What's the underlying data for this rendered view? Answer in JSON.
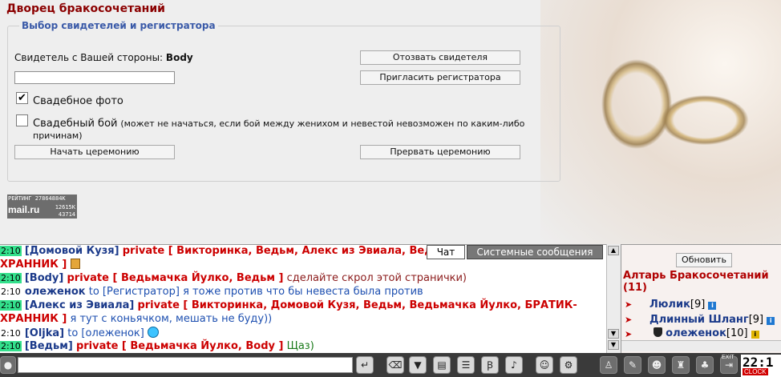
{
  "page_title": "Дворец бракосочетаний",
  "panel": {
    "legend": "Выбор свидетелей и регистратора",
    "witness_label": "Свидетель с Вашей стороны:",
    "witness_name": "Body",
    "recall_witness_button": "Отозвать свидетеля",
    "invite_registrar_button": "Пригласить регистратора",
    "registrar_input_value": "",
    "photo_checkbox": {
      "checked": true,
      "mark": "✔",
      "label": "Свадебное фото"
    },
    "fight_checkbox": {
      "checked": false,
      "label": "Свадебный бой",
      "note": "(может не начаться, если бой между женихом и невестой невозможен по каким-либо причинам)"
    },
    "start_ceremony_button": "Начать церемонию",
    "abort_ceremony_button": "Прервать церемонию"
  },
  "rating_widget": {
    "line1": "РЕЙТИНГ 27864884К",
    "logo": "mail.ru",
    "count2": "12615К",
    "count3": "43714"
  },
  "chat_tabs": {
    "chat": "Чат",
    "system": "Системные сообщения"
  },
  "chat_messages": [
    {
      "time": "2:10",
      "nick": "[Домовой Кузя]",
      "private": "private [ Викторинка, Ведьм, Алекс из Эвиала, Вед",
      "continuation": "ХРАННИК ]"
    },
    {
      "time": "2:10",
      "nick": "[Body]",
      "private": "private [ Ведьмачка Йулко, Ведьм ]",
      "text": "сделайте скрол этой странички)"
    },
    {
      "time": "2:10",
      "nick": "олеженок",
      "to": "to [Регистратор]",
      "text": "я тоже против что бы невеста была против"
    },
    {
      "time": "2:10",
      "nick": "[Алекс из Эвиала]",
      "private": "private [ Викторинка, Домовой Кузя, Ведьм, Ведьмачка Йулко, БРАТИК-",
      "continuation": "ХРАННИК ]",
      "text": "я тут с коньячком, мешать не буду))"
    },
    {
      "time": "2:10",
      "nick": "[Oljka]",
      "to": "to [олеженок]",
      "text": ""
    },
    {
      "time": "2:10",
      "nick": "[Ведьм]",
      "private": "private [ Ведьмачка Йулко, Body ]",
      "text": "Щаз)"
    }
  ],
  "right_panel": {
    "refresh_button": "Обновить",
    "room_name": "Алтарь Бракосочетаний",
    "room_count": "(11)",
    "users": [
      {
        "name": "Люлик",
        "level": "[9]"
      },
      {
        "name": "Длинный Шланг",
        "level": "[9]"
      },
      {
        "name": "олеженок",
        "level": "[10]"
      }
    ]
  },
  "clock": {
    "time": "22:1",
    "label": "CLOCK"
  },
  "exit_label": "EXIT",
  "colors": {
    "title": "#8b0000",
    "legend": "#3a5aa8",
    "private": "#cc0000",
    "time_bg": "#33e08c"
  },
  "toolbar_icons": [
    "send-icon",
    "eraser-icon",
    "filter-icon",
    "clear-icon",
    "translit-icon",
    "font-icon",
    "speaker-icon",
    "smile-icon",
    "settings-icon"
  ]
}
